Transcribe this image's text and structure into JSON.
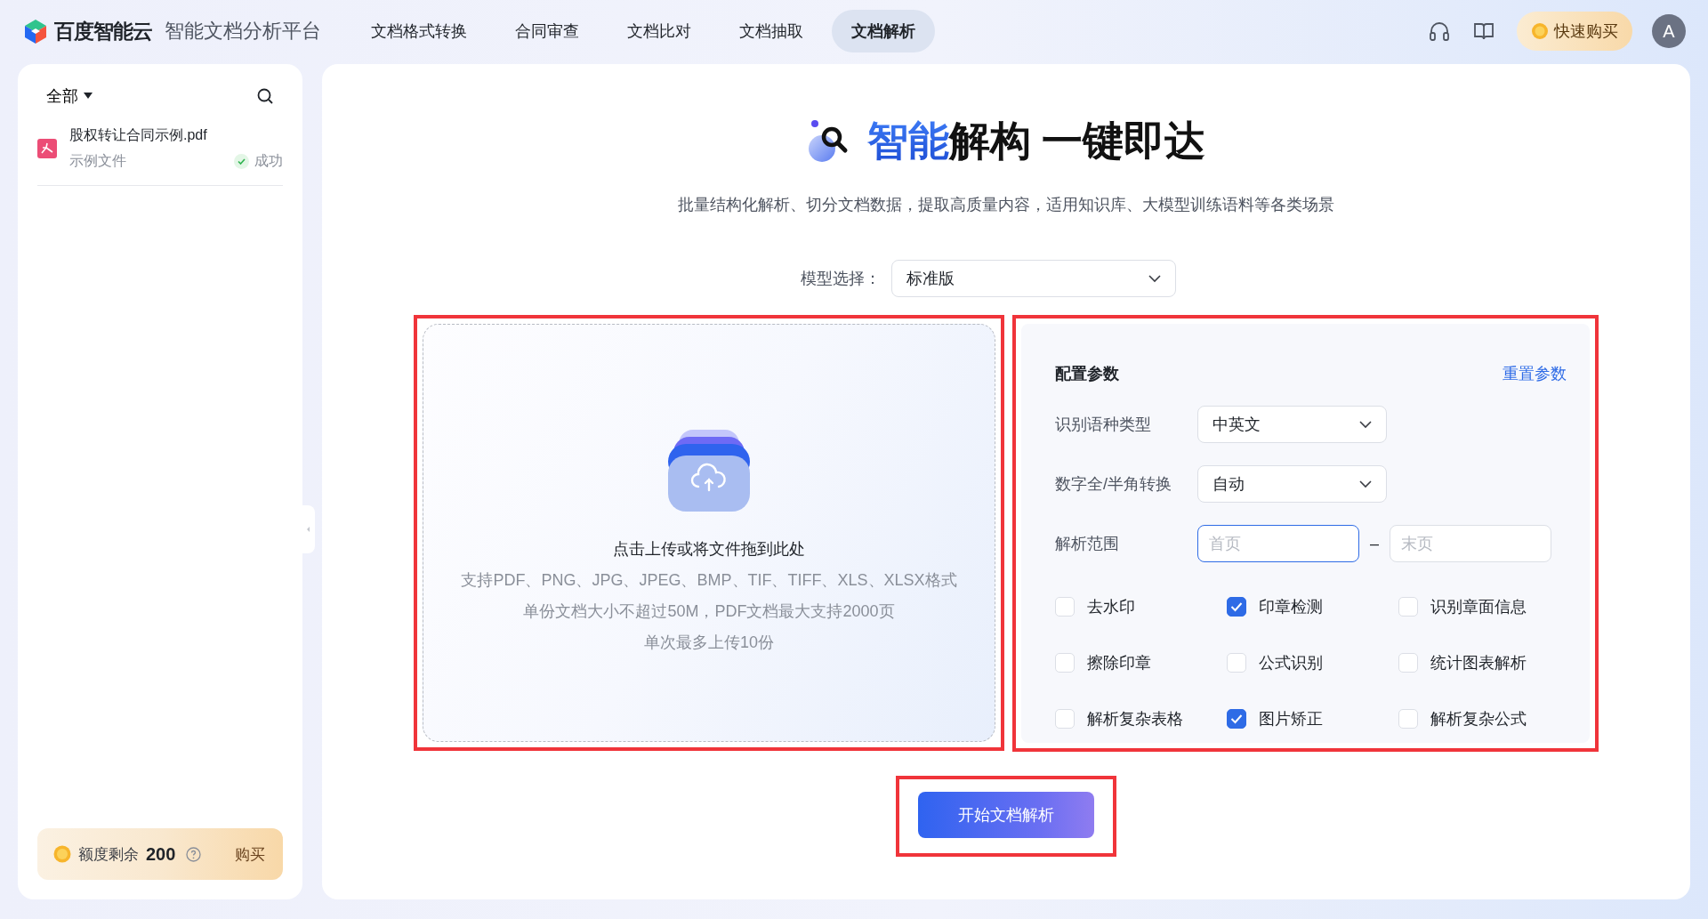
{
  "header": {
    "logo_text": "百度智能云",
    "platform_name": "智能文档分析平台",
    "nav": [
      {
        "label": "文档格式转换",
        "selected": false
      },
      {
        "label": "合同审查",
        "selected": false
      },
      {
        "label": "文档比对",
        "selected": false
      },
      {
        "label": "文档抽取",
        "selected": false
      },
      {
        "label": "文档解析",
        "selected": true
      }
    ],
    "buy_button": "快速购买",
    "avatar": "A"
  },
  "sidebar": {
    "filter": "全部",
    "files": [
      {
        "name": "股权转让合同示例.pdf",
        "tag": "示例文件",
        "status": "成功"
      }
    ],
    "quota": {
      "label": "额度剩余",
      "value": "200",
      "buy": "购买"
    }
  },
  "main": {
    "title": {
      "accent": "智能",
      "rest": "解构 一键即达"
    },
    "subtitle": "批量结构化解析、切分文档数据，提取高质量内容，适用知识库、大模型训练语料等各类场景",
    "model": {
      "label": "模型选择：",
      "value": "标准版"
    },
    "upload": {
      "annotated": true,
      "prompt": "点击上传或将文件拖到此处",
      "notes": [
        "支持PDF、PNG、JPG、JPEG、BMP、TIF、TIFF、XLS、XLSX格式",
        "单份文档大小不超过50M，PDF文档最大支持2000页",
        "单次最多上传10份"
      ]
    },
    "config": {
      "annotated": true,
      "title": "配置参数",
      "reset": "重置参数",
      "selects": [
        {
          "label": "识别语种类型",
          "value": "中英文"
        },
        {
          "label": "数字全/半角转换",
          "value": "自动"
        }
      ],
      "range": {
        "label": "解析范围",
        "separator": "–",
        "from": {
          "placeholder": "首页",
          "focused": true
        },
        "to": {
          "placeholder": "末页",
          "focused": false
        }
      },
      "options": [
        {
          "label": "去水印",
          "checked": false
        },
        {
          "label": "印章检测",
          "checked": true
        },
        {
          "label": "识别章面信息",
          "checked": false
        },
        {
          "label": "擦除印章",
          "checked": false
        },
        {
          "label": "公式识别",
          "checked": false
        },
        {
          "label": "统计图表解析",
          "checked": false
        },
        {
          "label": "解析复杂表格",
          "checked": false
        },
        {
          "label": "图片矫正",
          "checked": true
        },
        {
          "label": "解析复杂公式",
          "checked": false
        }
      ]
    },
    "start": {
      "annotated": true,
      "label": "开始文档解析"
    }
  }
}
